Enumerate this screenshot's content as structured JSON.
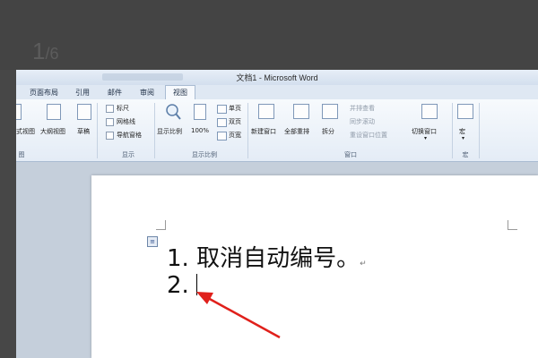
{
  "background": {
    "page_counter": "1",
    "page_counter_total": "/6"
  },
  "window": {
    "title": "文档1 - Microsoft Word",
    "tabs": [
      {
        "label": "页面布局"
      },
      {
        "label": "引用"
      },
      {
        "label": "邮件"
      },
      {
        "label": "审阅"
      },
      {
        "label": "视图",
        "active": true
      }
    ]
  },
  "ribbon": {
    "views_group": {
      "label": "图",
      "buttons": [
        "式视图",
        "大纲视图",
        "草稿"
      ]
    },
    "show_group": {
      "label": "显示",
      "checkboxes": [
        "标尺",
        "网格线",
        "导航窗格"
      ]
    },
    "zoom_group": {
      "label": "显示比例",
      "zoom_button": "显示比例",
      "hundred_button": "100%",
      "small_buttons": [
        "单页",
        "双页",
        "页宽"
      ]
    },
    "window_group": {
      "label": "窗口",
      "buttons": [
        "新建窗口",
        "全部重排",
        "拆分"
      ],
      "disabled_items": [
        "并排查看",
        "同步滚动",
        "重设窗口位置"
      ],
      "switch_button": "切换窗口"
    },
    "macro_group": {
      "label": "宏",
      "button": "宏"
    }
  },
  "document": {
    "line1": "1. 取消自动编号。",
    "line1_mark": "↵",
    "line2": "2."
  },
  "colors": {
    "arrow": "#e0201b",
    "ribbon_bg": "#eef3fa",
    "workspace": "#c5cfdb"
  }
}
